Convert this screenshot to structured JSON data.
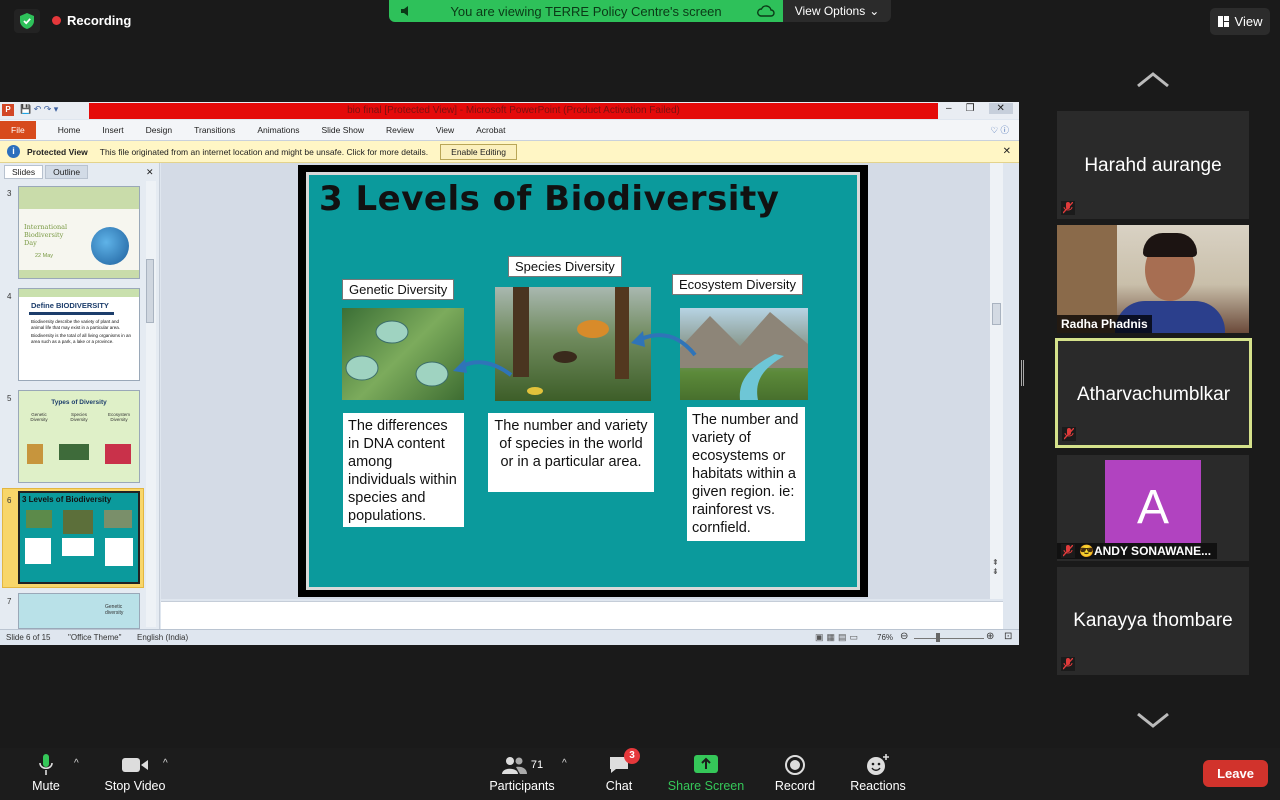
{
  "meeting": {
    "recording_label": "Recording",
    "banner_text": "You are viewing TERRE Policy Centre's screen",
    "view_options_label": "View Options",
    "view_button_label": "View"
  },
  "powerpoint": {
    "window_title": "bio final [Protected View] - Microsoft PowerPoint (Product Activation Failed)",
    "tabs": [
      "File",
      "Home",
      "Insert",
      "Design",
      "Transitions",
      "Animations",
      "Slide Show",
      "Review",
      "View",
      "Acrobat"
    ],
    "protected_view": {
      "label": "Protected View",
      "message": "This file originated from an internet location and might be unsafe. Click for more details.",
      "button": "Enable Editing"
    },
    "pane_tabs": [
      "Slides",
      "Outline"
    ],
    "thumbnails": [
      {
        "number": "3",
        "title": "International Biodiversity Day",
        "date": "22 May"
      },
      {
        "number": "4",
        "title": "Define BIODIVERSITY",
        "bullet1": "Biodiversity describe the variety of plant and animal life that may exist in a particular area.",
        "bullet2": "Biodiversity is the total of all living organisms in an area such as a park, a lake or a province."
      },
      {
        "number": "5",
        "title": "Types of Diversity",
        "cols": [
          "Genetic Diversity",
          "Species Diversity",
          "Ecosystem Diversity"
        ]
      },
      {
        "number": "6",
        "title": "3 Levels of Biodiversity"
      },
      {
        "number": "7",
        "title": "Genetic diversity"
      }
    ],
    "slide": {
      "title": "3 Levels of Biodiversity",
      "genetic_label": "Genetic Diversity",
      "species_label": "Species Diversity",
      "ecosystem_label": "Ecosystem Diversity",
      "genetic_desc": "The differences in DNA content among individuals within species and populations.",
      "species_desc": "The number and variety of species in the world or in a particular area.",
      "ecosystem_desc": "The number and variety of ecosystems or habitats within a given region. ie: rainforest vs. cornfield."
    },
    "status": {
      "slide_of": "Slide 6 of 15",
      "theme": "\"Office Theme\"",
      "language": "English (India)",
      "zoom": "76%"
    }
  },
  "participants_panel": [
    {
      "name": "Harahd aurange",
      "muted": true
    },
    {
      "name": "Radha Phadnis",
      "muted": false
    },
    {
      "name": "Atharvachumblkar",
      "muted": true,
      "active": true
    },
    {
      "name": "😎ANDY SONAWANE...",
      "initial": "A",
      "avatar_color": "#b143c0",
      "muted": true
    },
    {
      "name": "Kanayya thombare",
      "muted": true
    }
  ],
  "toolbar": {
    "mute": "Mute",
    "stop_video": "Stop Video",
    "participants": "Participants",
    "participants_count": "71",
    "chat": "Chat",
    "chat_badge": "3",
    "share_screen": "Share Screen",
    "record": "Record",
    "reactions": "Reactions",
    "leave": "Leave"
  },
  "colors": {
    "share_green": "#2ec15a",
    "leave_red": "#d1332c",
    "slide_teal": "#0b9a9c",
    "active_border": "#d5e28b"
  }
}
